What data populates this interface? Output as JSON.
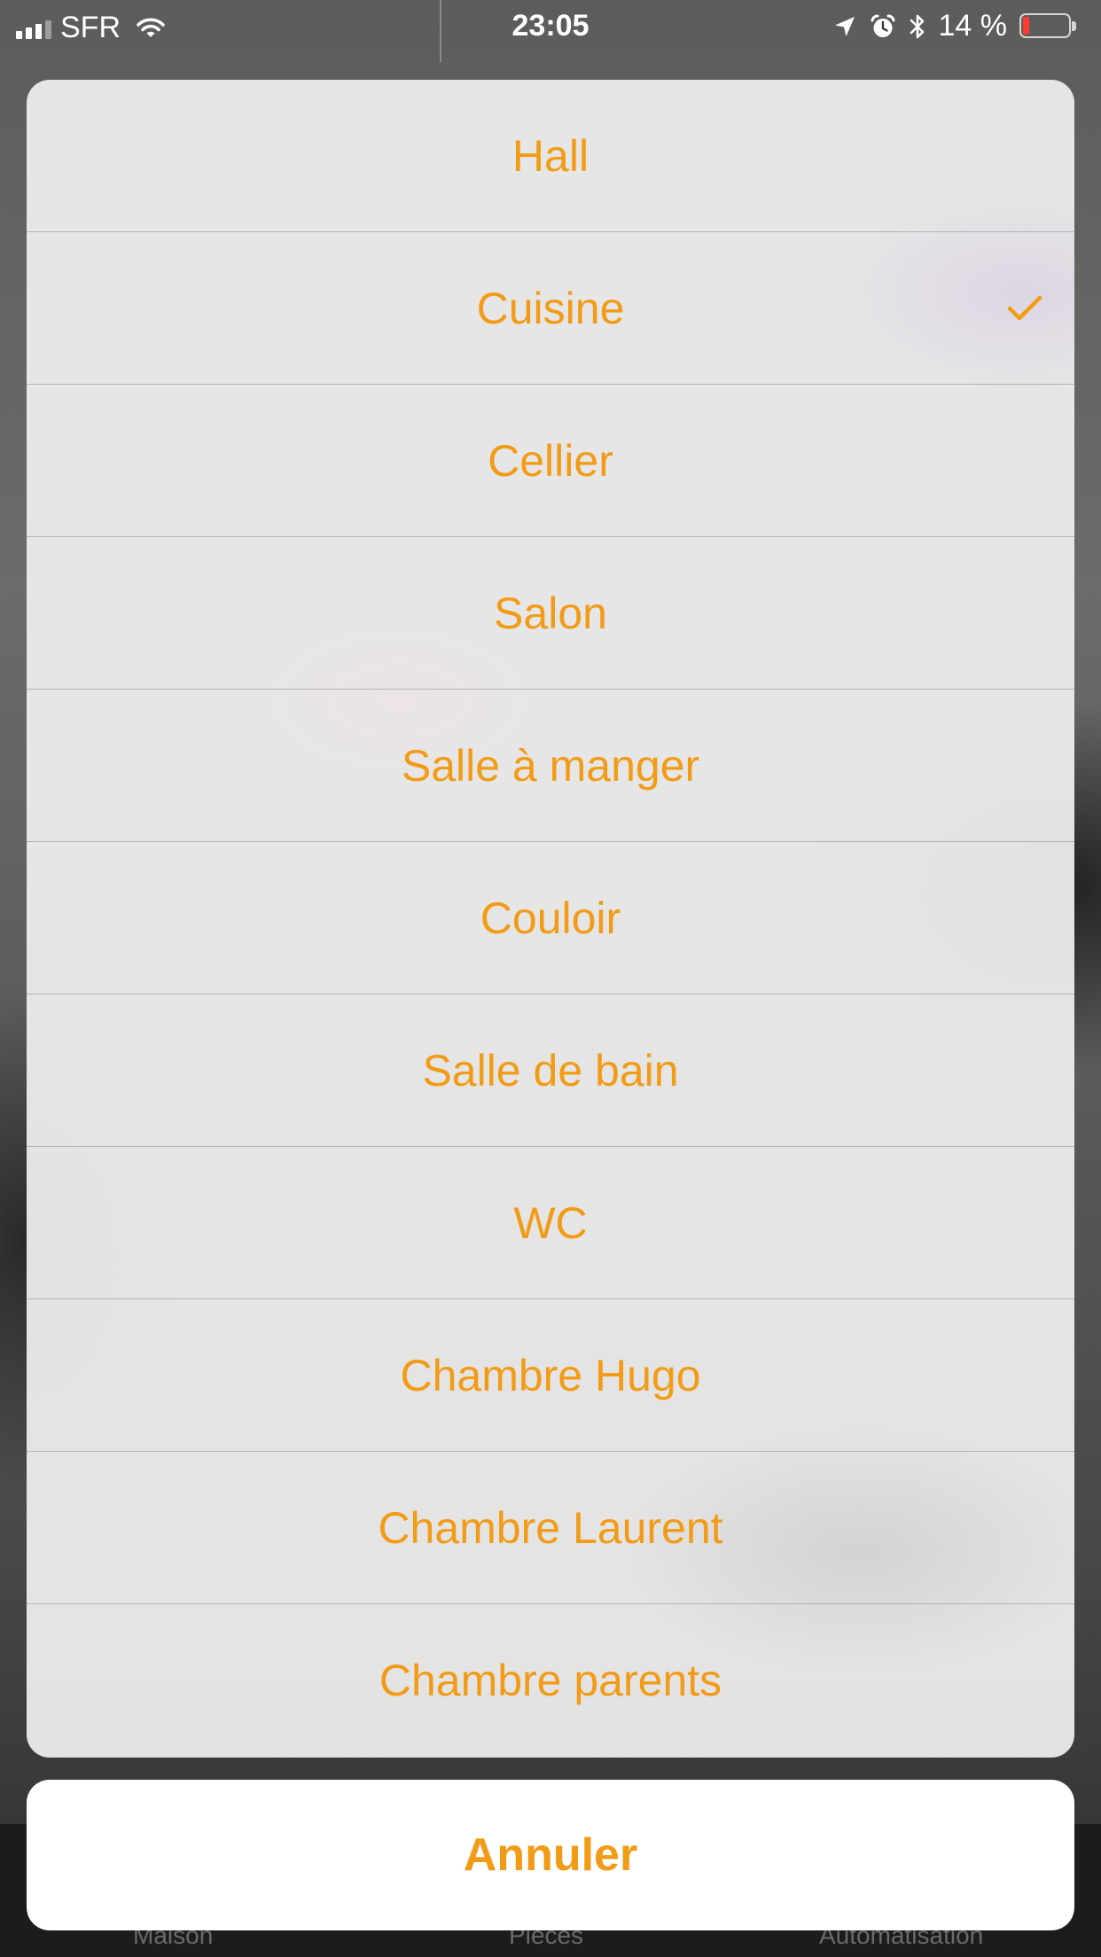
{
  "status_bar": {
    "carrier": "SFR",
    "time": "23:05",
    "battery_text": "14 %",
    "battery_level": 0.14,
    "battery_color": "#ff3b30",
    "icons": [
      "signal-icon",
      "wifi-icon",
      "location-arrow-icon",
      "alarm-icon",
      "bluetooth-icon",
      "battery-icon"
    ]
  },
  "accent_color": "#f29b16",
  "room_sheet": {
    "selected": "Cuisine",
    "items": [
      {
        "label": "Hall",
        "checked": false
      },
      {
        "label": "Cuisine",
        "checked": true
      },
      {
        "label": "Cellier",
        "checked": false
      },
      {
        "label": "Salon",
        "checked": false
      },
      {
        "label": "Salle à manger",
        "checked": false
      },
      {
        "label": "Couloir",
        "checked": false
      },
      {
        "label": "Salle de bain",
        "checked": false
      },
      {
        "label": "WC",
        "checked": false
      },
      {
        "label": "Chambre Hugo",
        "checked": false
      },
      {
        "label": "Chambre Laurent",
        "checked": false
      },
      {
        "label": "Chambre parents",
        "checked": false
      }
    ],
    "cancel_label": "Annuler"
  },
  "background_tabs": {
    "items": [
      "Maison",
      "Pièces",
      "Automatisation"
    ]
  }
}
